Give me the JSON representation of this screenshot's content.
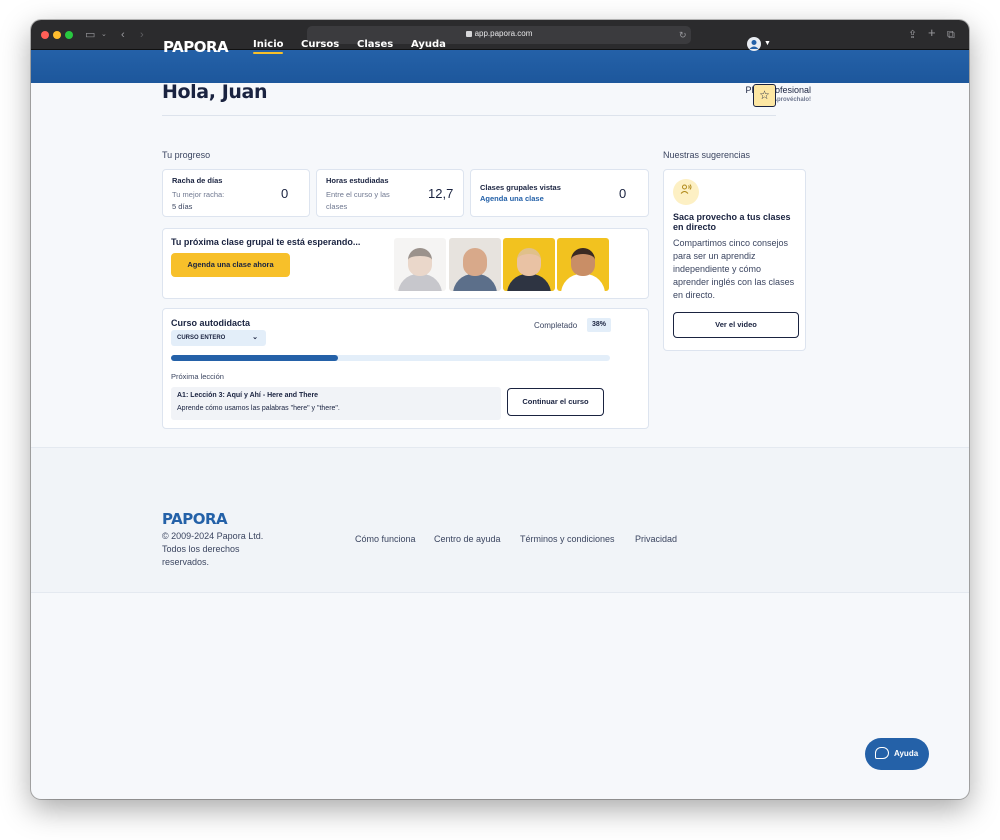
{
  "browser": {
    "url": "app.papora.com"
  },
  "header": {
    "logo": "PAPORA",
    "nav": [
      "Inicio",
      "Cursos",
      "Clases",
      "Ayuda"
    ]
  },
  "greeting": "Hola, Juan",
  "plan": {
    "name": "Plan Profesional",
    "sub": "¡Aprovéchalo!"
  },
  "progress_section": {
    "label": "Tu progreso",
    "streak": {
      "title": "Racha de días",
      "sub1": "Tu mejor racha:",
      "sub2": "5 días",
      "value": "0"
    },
    "hours": {
      "title": "Horas estudiadas",
      "sub1": "Entre el curso y las",
      "sub2": "clases",
      "value": "12,7"
    },
    "group": {
      "title": "Clases grupales vistas",
      "link": "Agenda una clase",
      "value": "0"
    }
  },
  "banner": {
    "title": "Tu próxima clase grupal te está esperando...",
    "button": "Agenda una clase ahora"
  },
  "course": {
    "title": "Curso autodidacta",
    "select": "CURSO ENTERO",
    "completed_label": "Completado",
    "completed_value": "38%",
    "progress_fraction": 0.38,
    "next_label": "Próxima lección",
    "lesson_title": "A1: Lección 3: Aquí y Ahí - Here and There",
    "lesson_desc": "Aprende cómo usamos las palabras \"here\" y \"there\".",
    "button": "Continuar el curso"
  },
  "suggestions": {
    "label": "Nuestras sugerencias",
    "title": "Saca provecho a tus clases en directo",
    "text": "Compartimos cinco consejos para ser un aprendiz independiente y cómo aprender inglés con las clases en directo.",
    "button": "Ver el video"
  },
  "footer": {
    "logo": "PAPORA",
    "copyright": "© 2009-2024 Papora Ltd. Todos los derechos reservados.",
    "links": [
      "Cómo funciona",
      "Centro de ayuda",
      "Términos y condiciones",
      "Privacidad"
    ]
  },
  "help": {
    "label": "Ayuda"
  }
}
